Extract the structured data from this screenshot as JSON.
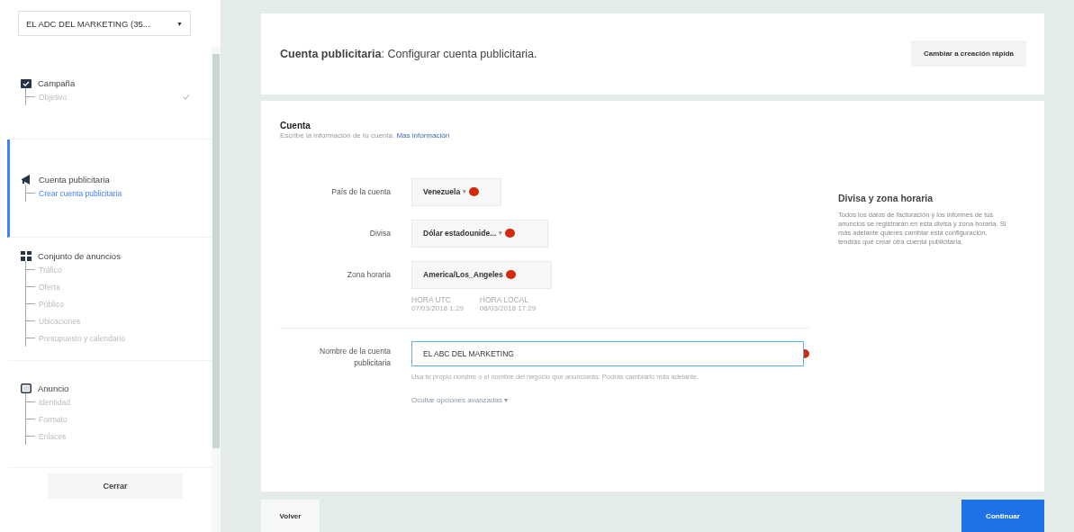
{
  "account_selector": {
    "label": "EL ADC DEL MARKETING (35...",
    "caret": "▼"
  },
  "sidebar": {
    "sections": [
      {
        "kind": "campaign",
        "title": "Campaña",
        "selected": false,
        "children": [
          {
            "label": "Objetivo",
            "selected": false,
            "completed": true
          }
        ]
      },
      {
        "kind": "account",
        "title": "Cuenta publicitaria",
        "selected": true,
        "children": [
          {
            "label": "Crear cuenta publicitaria",
            "selected": true,
            "completed": false
          }
        ]
      },
      {
        "kind": "adset",
        "title": "Conjunto de anuncios",
        "selected": false,
        "children": [
          {
            "label": "Tráfico",
            "selected": false,
            "completed": false
          },
          {
            "label": "Oferta",
            "selected": false,
            "completed": false
          },
          {
            "label": "Público",
            "selected": false,
            "completed": false
          },
          {
            "label": "Ubicaciones",
            "selected": false,
            "completed": false
          },
          {
            "label": "Presupuesto y calendario",
            "selected": false,
            "completed": false
          }
        ]
      },
      {
        "kind": "ad",
        "title": "Anuncio",
        "selected": false,
        "children": [
          {
            "label": "Identidad",
            "selected": false,
            "completed": false
          },
          {
            "label": "Formato",
            "selected": false,
            "completed": false
          },
          {
            "label": "Enlaces",
            "selected": false,
            "completed": false
          }
        ]
      }
    ],
    "close_button": "Cerrar"
  },
  "header": {
    "title": "**Cuenta publicitaria**: Configurar cuenta publicitaria.",
    "button": "Cambiar a creación rápida"
  },
  "form": {
    "title": "Cuenta",
    "description": "Escribe la información de tu cuenta.",
    "link": "Más información",
    "fields": [
      {
        "label": "País de la cuenta",
        "value": "Venezuela",
        "caret": "▾"
      },
      {
        "label": "Divisa",
        "value": "Dólar estadounide...",
        "caret": "▾"
      },
      {
        "label": "Zona horaria",
        "value": "America/Los_Angeles"
      }
    ],
    "times": [
      {
        "label": "HORA UTC",
        "value": "07/03/2018 1:29"
      },
      {
        "label": "HORA LOCAL",
        "value": "06/03/2018 17:29"
      }
    ],
    "name_field": {
      "label": "Nombre de la cuenta publicitaria",
      "value": "EL ABC DEL MARKETING",
      "hint": "Usa tu propio nombre o el nombre del negocio que anunciarás. Podrás cambiarlo más adelante.",
      "toggle": "Ocultar opciones avanzadas ▾"
    },
    "info": {
      "title": "Divisa y zona horaria",
      "text": "Todos los datos de facturación y los informes de tus anuncios se registrarán en esta divisa y zona horaria. Si más adelante quieres cambiar esta configuración, tendrás que crear otra cuenta publicitaria."
    }
  },
  "footer": {
    "back_button": "Volver",
    "continue_button": "Continuar"
  }
}
